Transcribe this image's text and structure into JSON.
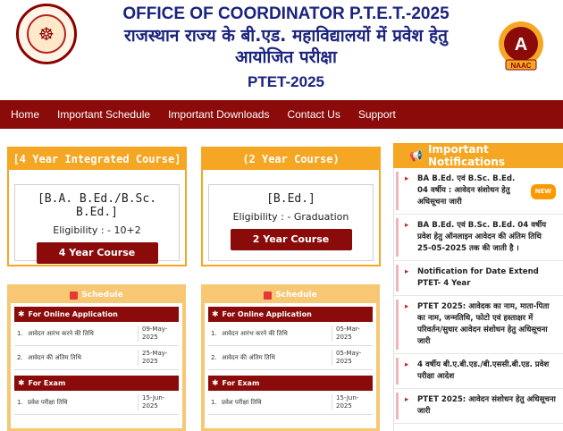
{
  "header": {
    "title_en": "OFFICE OF COORDINATOR P.T.E.T.-2025",
    "title_hi_line1": "राजस्थान राज्य के बी.एड. महाविद्यालयों में प्रवेश हेतु",
    "title_hi_line2": "आयोजित परीक्षा",
    "subtitle": "PTET-2025",
    "naac_grade": "A",
    "naac_label": "NAAC"
  },
  "nav": [
    "Home",
    "Important Schedule",
    "Important Downloads",
    "Contact Us",
    "Support"
  ],
  "courses": [
    {
      "header": "[4 Year Integrated Course]",
      "name": "[B.A. B.Ed./B.Sc. B.Ed.]",
      "eligibility": "Eligibility : - 10+2",
      "button": "4 Year Course"
    },
    {
      "header": "(2 Year Course)",
      "name": "[B.Ed.]",
      "eligibility": "Eligibility : - Graduation",
      "button": "2 Year Course"
    }
  ],
  "schedules": [
    {
      "title": "Schedule",
      "online_label": "For Online Application",
      "exam_label": "For Exam",
      "rows": [
        {
          "n": "1.",
          "label": "आवेदन आरंभ करने की तिथि",
          "date": "09-May-2025"
        },
        {
          "n": "2.",
          "label": "आवेदन की अंतिम तिथि",
          "date": "25-May-2025"
        }
      ],
      "exam_rows": [
        {
          "n": "1.",
          "label": "प्रवेश परीक्षा तिथि",
          "date": "15-Jun-2025"
        }
      ]
    },
    {
      "title": "Schedule",
      "online_label": "For Online Application",
      "exam_label": "For Exam",
      "rows": [
        {
          "n": "1.",
          "label": "आवेदन आरंभ करने की तिथि",
          "date": "05-Mar-2025"
        },
        {
          "n": "2.",
          "label": "आवेदन की अंतिम तिथि",
          "date": "05-May-2025"
        }
      ],
      "exam_rows": [
        {
          "n": "1.",
          "label": "प्रवेश परीक्षा तिथि",
          "date": "15-Jun-2025"
        }
      ]
    }
  ],
  "notifications": {
    "title": "Important Notifications",
    "new_badge": "NEW",
    "items": [
      "BA B.Ed. एवं B.Sc. B.Ed. 04 वर्षीय : आवेदन संशोधन हेतु अधिसूचना जारी",
      "BA B.Ed. एवं B.Sc. B.Ed. 04 वर्षीय प्रवेश हेतु ऑनलाइन आवेदन की अंतिम तिथि 25-05-2025 तक की जाती है ।",
      "Notification for Date Extend PTET- 4 Year",
      "PTET 2025: आवेदक का नाम, माता-पिता का नाम, जन्मतिथि, फोटो एवं हस्ताक्षर में परिवर्तन/सुधार आवेदन संशोधन हेतु अधिसूचना जारी",
      "4 वर्षीय बी.ए.बी.एड./बी.एससी.बी.एड. प्रवेश परीक्षा आदेश",
      "PTET 2025: आवेदन संशोधन हेतु अधिसूचना जारी"
    ]
  },
  "colors": {
    "maroon": "#8b0a0a",
    "orange": "#f5a623",
    "navy": "#1a237e"
  }
}
